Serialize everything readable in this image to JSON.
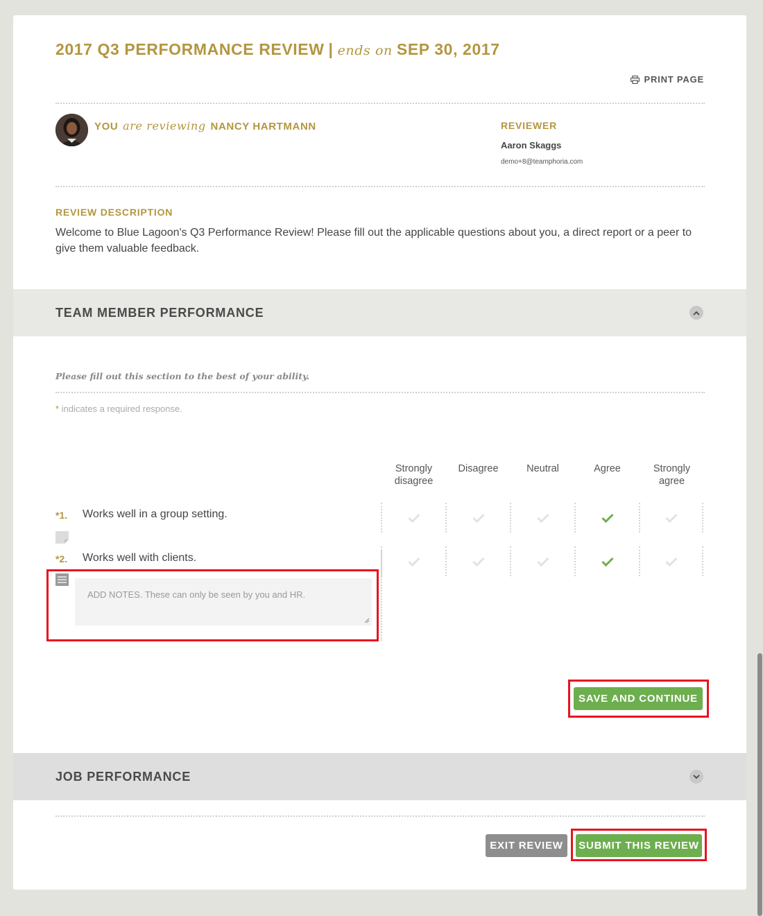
{
  "header": {
    "title": "2017 Q3 PERFORMANCE REVIEW",
    "separator": "|",
    "ends_label": "ends on",
    "end_date": "SEP 30, 2017",
    "print_label": "PRINT PAGE"
  },
  "reviewee": {
    "you": "YOU",
    "are_reviewing": "are reviewing",
    "name": "NANCY HARTMANN"
  },
  "reviewer": {
    "label": "REVIEWER",
    "name": "Aaron Skaggs",
    "email": "demo+8@teamphoria.com"
  },
  "description": {
    "label": "REVIEW DESCRIPTION",
    "text": "Welcome to Blue Lagoon's Q3 Performance Review! Please fill out the applicable questions about you, a direct report or a peer to give them valuable feedback."
  },
  "sections": {
    "team": {
      "title": "TEAM MEMBER PERFORMANCE",
      "instructions": "Please fill out this section to the best of your ability.",
      "required_star": "*",
      "required_note": " indicates a required response.",
      "scale": [
        "Strongly disagree",
        "Disagree",
        "Neutral",
        "Agree",
        "Strongly agree"
      ],
      "questions": [
        {
          "number": "*1.",
          "text": "Works well in a group setting.",
          "selected_index": 3
        },
        {
          "number": "*2.",
          "text": "Works well with clients.",
          "selected_index": 3
        }
      ],
      "notes_placeholder": "ADD NOTES. These can only be seen by you and HR.",
      "save_label": "SAVE AND CONTINUE"
    },
    "job": {
      "title": "JOB PERFORMANCE"
    }
  },
  "footer": {
    "exit_label": "EXIT REVIEW",
    "submit_label": "SUBMIT THIS REVIEW"
  },
  "colors": {
    "gold": "#b3963f",
    "green": "#6dae4f",
    "check_inactive": "#e2e2e2",
    "highlight": "#e8131f"
  },
  "icons": {
    "print": "printer-icon",
    "collapse": "chevron-up-icon",
    "expand": "chevron-down-icon",
    "check": "check-icon",
    "note": "note-icon"
  }
}
